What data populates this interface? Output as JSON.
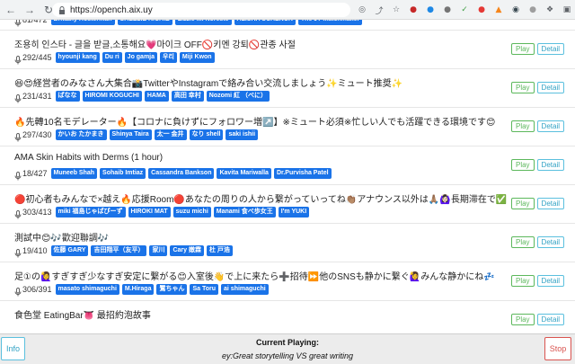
{
  "browser": {
    "url": "https://opench.aix.uy",
    "extensions": [
      {
        "name": "cast-icon",
        "color": "#5f6368",
        "glyph": "◎"
      },
      {
        "name": "share-icon",
        "color": "#5f6368",
        "glyph": "⤴"
      },
      {
        "name": "star-icon",
        "color": "#5f6368",
        "glyph": "☆"
      },
      {
        "name": "extension-lastpass-icon",
        "color": "#c62828",
        "glyph": "●"
      },
      {
        "name": "extension-blue-icon",
        "color": "#1e88e5",
        "glyph": "●"
      },
      {
        "name": "extension-gray-icon",
        "color": "#757575",
        "glyph": "●"
      },
      {
        "name": "extension-green-icon",
        "color": "#43a047",
        "glyph": "✓"
      },
      {
        "name": "extension-red-icon",
        "color": "#e53935",
        "glyph": "●"
      },
      {
        "name": "extension-metamask-icon",
        "color": "#f6851b",
        "glyph": "▲"
      },
      {
        "name": "extension-dark-icon",
        "color": "#37474f",
        "glyph": "◉"
      },
      {
        "name": "extension-gray2-icon",
        "color": "#9e9e9e",
        "glyph": "●"
      },
      {
        "name": "puzzle-icon",
        "color": "#5f6368",
        "glyph": "❖"
      },
      {
        "name": "sidebar-icon",
        "color": "#5f6368",
        "glyph": "▣"
      }
    ]
  },
  "rooms": [
    {
      "title": "",
      "count": "81/472",
      "tags": [
        "Brittany Hosterman",
        "SHELLIE RICHIE",
        "Lizzie M. Noreste",
        "ALISHA SCHENCK",
        "The JT Matchmaker"
      ]
    },
    {
      "title": "조용히 인스타 - 글을 받글,소통해요💗마이크 OFF🚫키멘 강퇴🚫관종 사절",
      "count": "292/445",
      "tags": [
        "hyounji kang",
        "Du ri",
        "Jo gamja",
        "우리",
        "Miji Kwon"
      ]
    },
    {
      "title": "😆😍経営者のみなさん大集合📸TwitterやInstagramで絡み合い交流しましょう✨ミュート推奨✨",
      "count": "231/431",
      "tags": [
        "ぱなな",
        "HIROMI KOGUCHI",
        "HAMA",
        "高田 幸村",
        "Nozomi 紅 （べに）"
      ]
    },
    {
      "title": "🔥先轉10名モデレーター🔥【コロナに負けずにフォロワー増↗️】※ミュート必須※忙しい人でも活躍できる環境です😊",
      "count": "297/430",
      "tags": [
        "かいお たかまき",
        "Shinya Taira",
        "太一 金井",
        "なり shell",
        "saki ishii"
      ]
    },
    {
      "title": "AMA Skin Habits with Derms (1 hour)",
      "count": "18/427",
      "tags": [
        "Muneeb Shah",
        "Sohaib Imtiaz",
        "Cassandra Bankson",
        "Kavita Mariwalla",
        "Dr.Purvisha Patel"
      ]
    },
    {
      "title": "🔴初心者もみんなで×越え🔥応援Room🔴あなたの周りの人から繋がっていってね👏🏽アナウンス以外は🙏🏽🙆🏻‍♀️長期滞在で✅",
      "count": "303/413",
      "tags": [
        "miki 福島じゃぱぴーず",
        "HIROKI MAT",
        "suzu michi",
        "Manami 食べ歩女王",
        "I'm YUKI"
      ]
    },
    {
      "title": "測試中😊🎶歡迎聯調🎶",
      "count": "19/410",
      "tags": [
        "佐藤 GARY",
        "吉田翔平（友平）",
        "家川",
        "Cary 嫩霖",
        "杜 戸浩"
      ]
    },
    {
      "title": "足①の🙋‍♀️すぎすぎ少なすぎ安定に繋がる😊入室後👋で上に来たら➕招待⏩他のSNSも静かに繋ぐ🙋‍♀️みんな静かにね💤",
      "count": "306/391",
      "tags": [
        "masato shimaguchi",
        "M.Hiraga",
        "鷺ちゃん",
        "Sa Toru",
        "ai shimaguchi"
      ]
    },
    {
      "title": "食色堂 EatingBar👅 最招約泡故事",
      "count": "",
      "tags": []
    }
  ],
  "buttons": {
    "play": "Play",
    "detail": "Detail",
    "info": "Info",
    "stop": "Stop"
  },
  "now_playing": {
    "label": "Current Playing:",
    "title": "ey:Great storytelling VS great writing"
  }
}
